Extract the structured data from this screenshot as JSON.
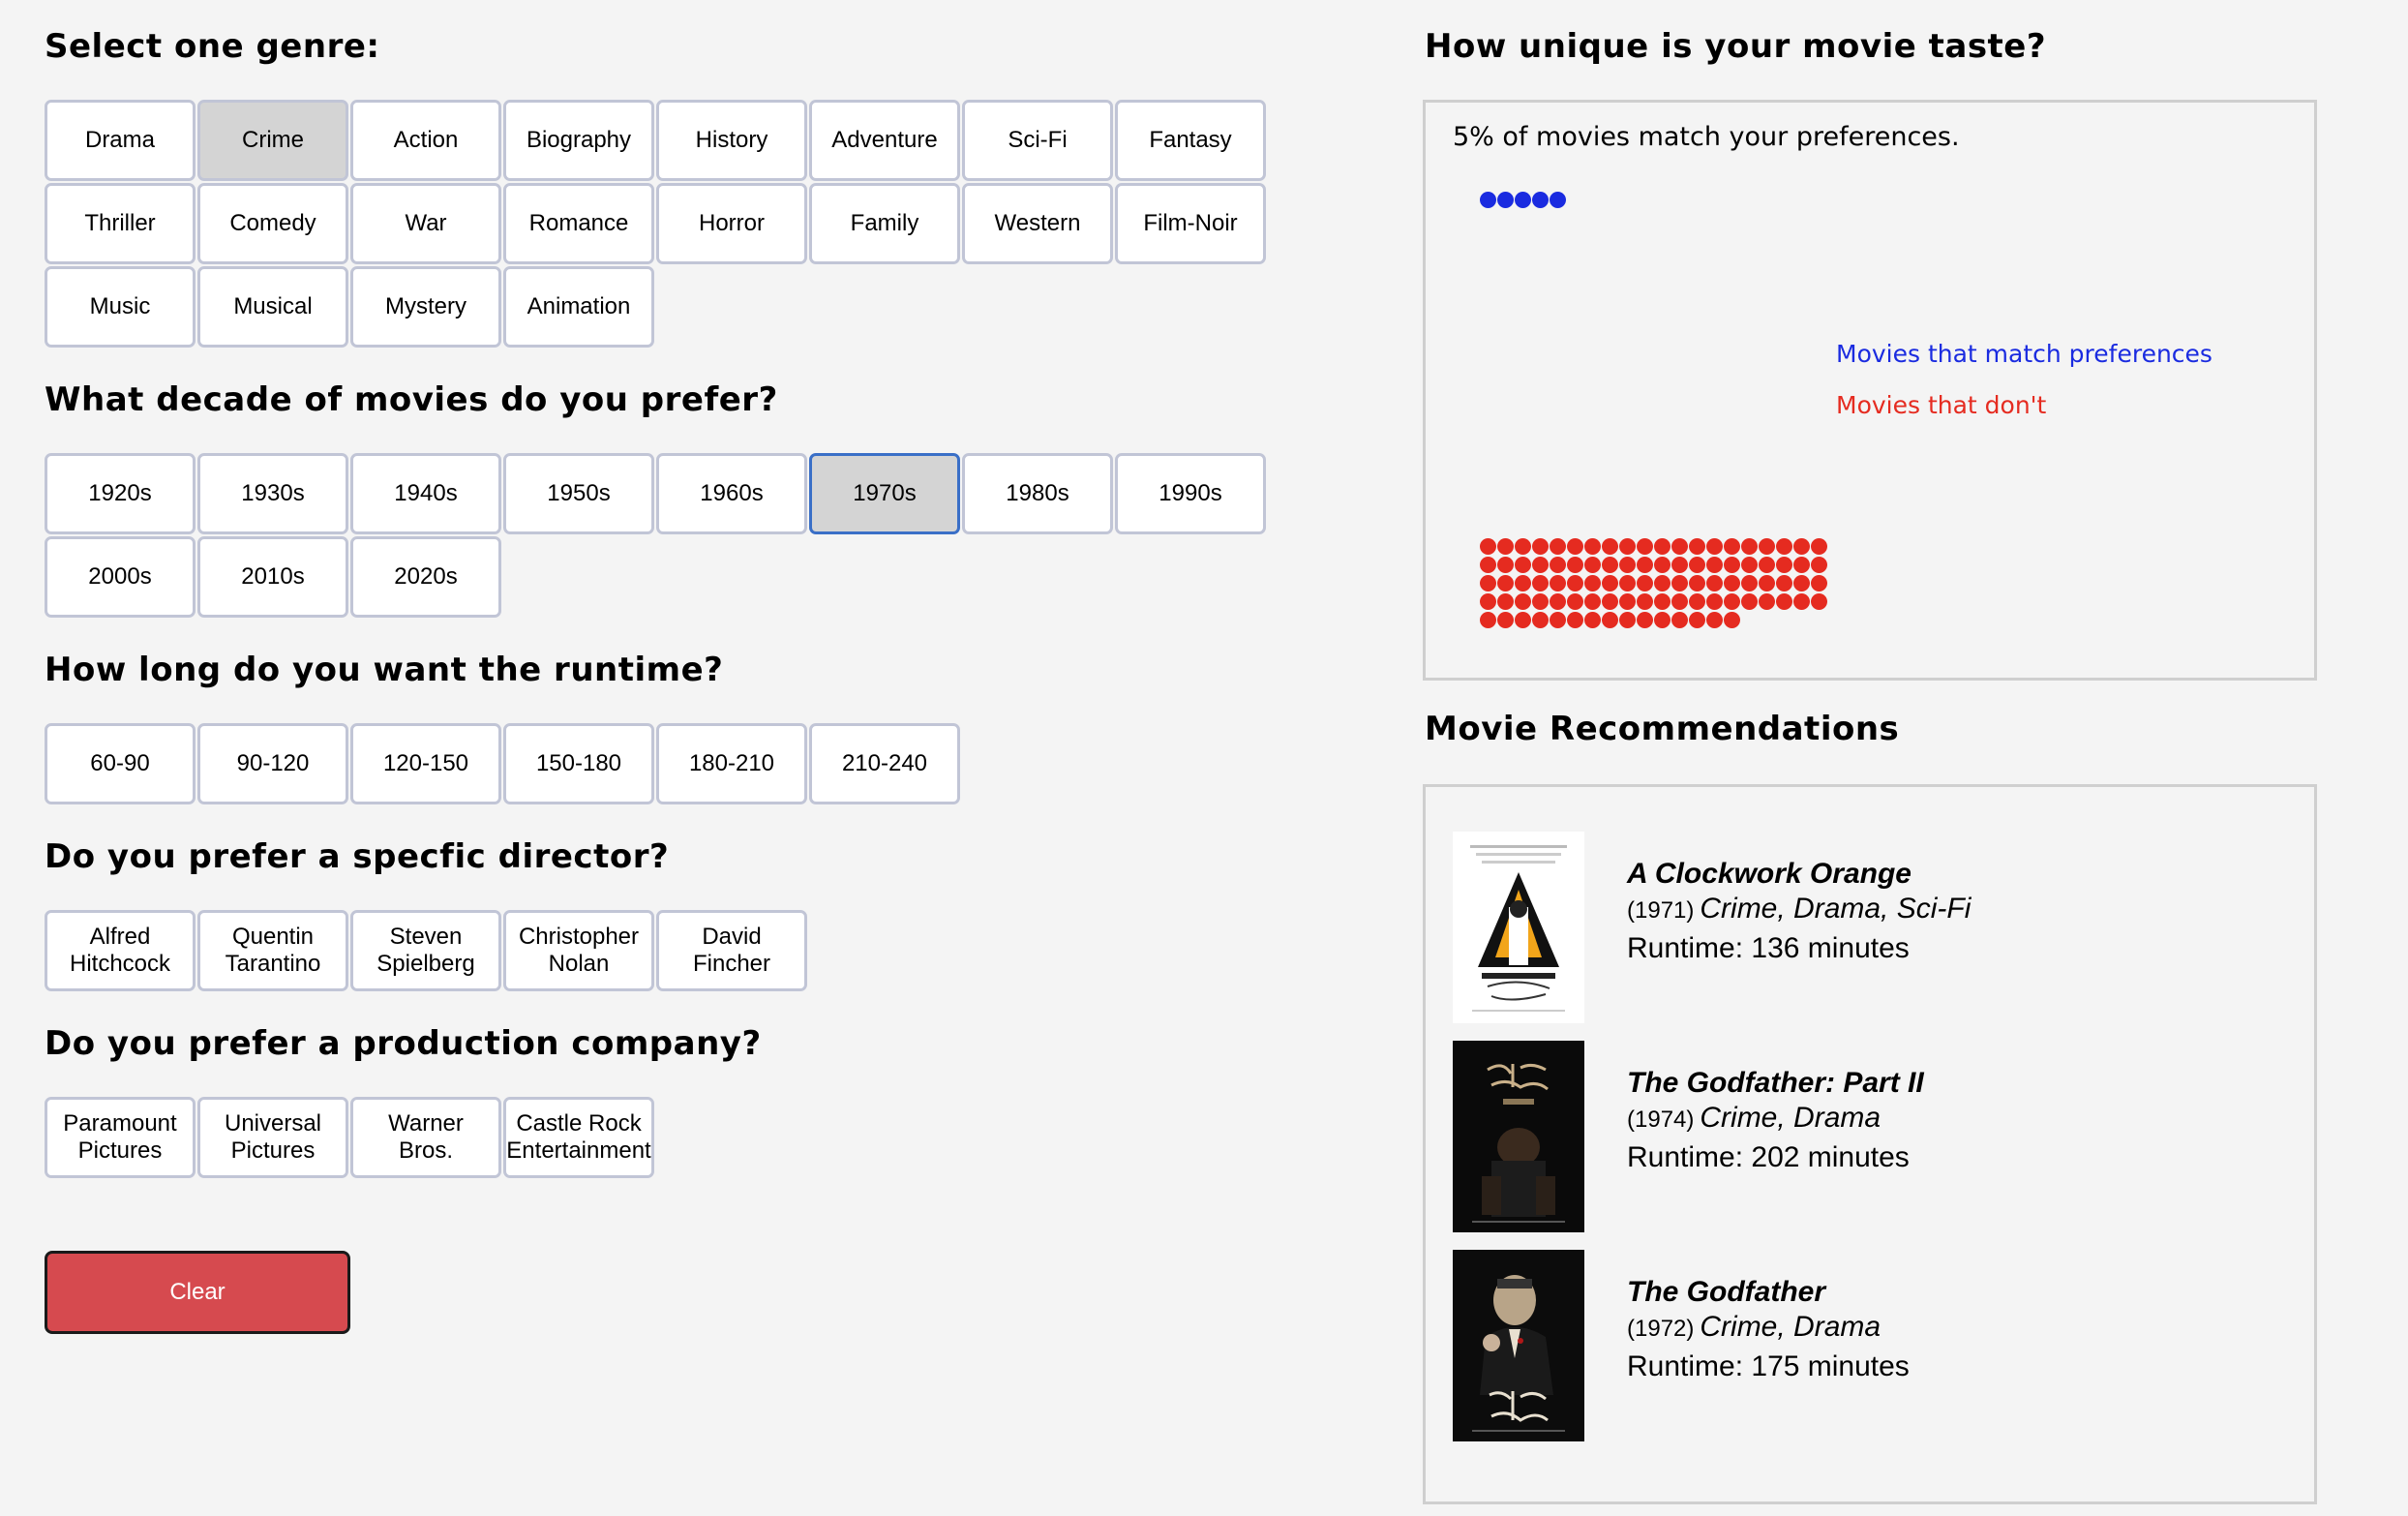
{
  "genre": {
    "title": "Select one genre:",
    "options": [
      "Drama",
      "Crime",
      "Action",
      "Biography",
      "History",
      "Adventure",
      "Sci-Fi",
      "Fantasy",
      "Thriller",
      "Comedy",
      "War",
      "Romance",
      "Horror",
      "Family",
      "Western",
      "Film-Noir",
      "Music",
      "Musical",
      "Mystery",
      "Animation"
    ],
    "selected": "Crime"
  },
  "decade": {
    "title": "What decade of movies do you prefer?",
    "options": [
      "1920s",
      "1930s",
      "1940s",
      "1950s",
      "1960s",
      "1970s",
      "1980s",
      "1990s",
      "2000s",
      "2010s",
      "2020s"
    ],
    "selected": "1970s"
  },
  "runtime": {
    "title": "How long do you want the runtime?",
    "options": [
      "60-90",
      "90-120",
      "120-150",
      "150-180",
      "180-210",
      "210-240"
    ]
  },
  "director": {
    "title": "Do you prefer a specfic director?",
    "options": [
      "Alfred\nHitchcock",
      "Quentin\nTarantino",
      "Steven\nSpielberg",
      "Christopher\nNolan",
      "David\nFincher"
    ]
  },
  "company": {
    "title": "Do you prefer a production company?",
    "options": [
      "Paramount\nPictures",
      "Universal\nPictures",
      "Warner\nBros.",
      "Castle Rock\nEntertainment"
    ]
  },
  "clear_label": "Clear",
  "uniqueness": {
    "title": "How unique is your movie taste?",
    "summary": "5% of movies match your preferences.",
    "match_count": 5,
    "nomatch_count": 95,
    "legend_match": "Movies that match preferences",
    "legend_nomatch": "Movies that don't",
    "colors": {
      "match": "#1a2be0",
      "nomatch": "#e52b20"
    }
  },
  "recommendations": {
    "title": "Movie Recommendations",
    "movies": [
      {
        "title": "A Clockwork Orange",
        "year": "(1971)",
        "genres": "Crime, Drama, Sci-Fi",
        "runtime": "Runtime: 136 minutes"
      },
      {
        "title": "The Godfather: Part II",
        "year": "(1974)",
        "genres": "Crime, Drama",
        "runtime": "Runtime: 202 minutes"
      },
      {
        "title": "The Godfather",
        "year": "(1972)",
        "genres": "Crime, Drama",
        "runtime": "Runtime: 175 minutes"
      }
    ]
  }
}
